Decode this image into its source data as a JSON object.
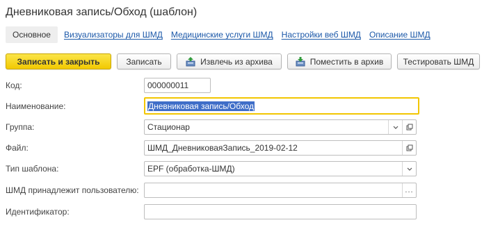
{
  "window": {
    "title": "Дневниковая запись/Обход (шаблон)"
  },
  "tabs": [
    {
      "label": "Основное",
      "active": true
    },
    {
      "label": "Визуализаторы для ШМД"
    },
    {
      "label": "Медицинские услуги ШМД"
    },
    {
      "label": "Настройки веб ШМД"
    },
    {
      "label": "Описание ШМД"
    }
  ],
  "toolbar": {
    "save_close": "Записать и закрыть",
    "save": "Записать",
    "extract": "Извлечь из архива",
    "archive": "Поместить в архив",
    "test": "Тестировать ШМД"
  },
  "form": {
    "code": {
      "label": "Код:",
      "value": "000000011"
    },
    "name": {
      "label": "Наименование:",
      "value": "Дневниковая запись/Обход"
    },
    "group": {
      "label": "Группа:",
      "value": "Стационар"
    },
    "file": {
      "label": "Файл:",
      "value": "ШМД_ДневниковаяЗапись_2019-02-12"
    },
    "template_type": {
      "label": "Тип шаблона:",
      "value": "EPF (обработка-ШМД)"
    },
    "owner": {
      "label": "ШМД принадлежит пользователю:",
      "value": ""
    },
    "identifier": {
      "label": "Идентификатор:",
      "value": ""
    }
  },
  "colors": {
    "accent": "#f2c900",
    "link": "#1a57a8",
    "selection": "#3f6ec8",
    "focus_border": "#f2c600"
  }
}
